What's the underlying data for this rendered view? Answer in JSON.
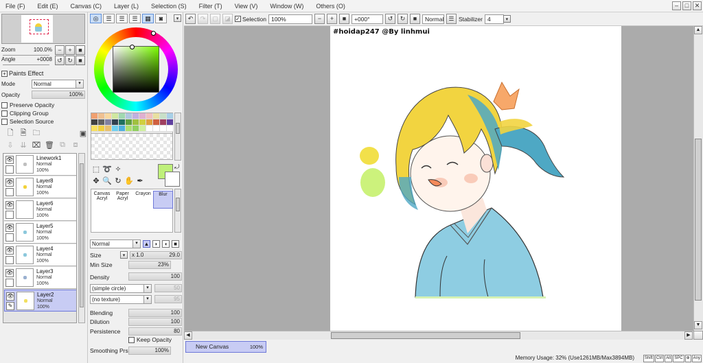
{
  "menu": [
    "File (F)",
    "Edit (E)",
    "Canvas (C)",
    "Layer (L)",
    "Selection (S)",
    "Filter (T)",
    "View (V)",
    "Window (W)",
    "Others (O)"
  ],
  "window_controls": [
    "–",
    "□",
    "✕"
  ],
  "navigator": {
    "zoom_label": "Zoom",
    "zoom_value": "100.0%",
    "angle_label": "Angle",
    "angle_value": "+0008"
  },
  "layer_props": {
    "paints_effect": "Paints Effect",
    "mode_label": "Mode",
    "mode_value": "Normal",
    "opacity_label": "Opacity",
    "opacity_value": "100%",
    "preserve_opacity": "Preserve Opacity",
    "clipping_group": "Clipping Group",
    "selection_source": "Selection Source"
  },
  "layers": [
    {
      "name": "Linework1",
      "mode": "Normal",
      "opacity": "100%",
      "dot": "#c0c0c0"
    },
    {
      "name": "Layer8",
      "mode": "Normal",
      "opacity": "100%",
      "dot": "#f2d23a"
    },
    {
      "name": "Layer6",
      "mode": "Normal",
      "opacity": "100%",
      "dot": "#ffffff"
    },
    {
      "name": "Layer5",
      "mode": "Normal",
      "opacity": "100%",
      "dot": "#8cc8dc"
    },
    {
      "name": "Layer4",
      "mode": "Normal",
      "opacity": "100%",
      "dot": "#8cc8dc"
    },
    {
      "name": "Layer3",
      "mode": "Normal",
      "opacity": "100%",
      "dot": "#9ab0d0"
    },
    {
      "name": "Layer2",
      "mode": "Normal",
      "opacity": "100%",
      "dot": "#f2e060"
    }
  ],
  "palette": [
    "#f0a070",
    "#f0c090",
    "#f8d8a0",
    "#d0e8a0",
    "#a0d8b0",
    "#b0c8e0",
    "#c0b0e0",
    "#e0b0d0",
    "#f0c0c0",
    "#e8e0a0",
    "#c8e0c8",
    "#a8d0e8",
    "#404040",
    "#606060",
    "#8080a0",
    "#304050",
    "#207060",
    "#60a040",
    "#a0c040",
    "#d0d040",
    "#e0a040",
    "#d06040",
    "#a04060",
    "#6040a0",
    "#f8e060",
    "#f0d040",
    "#e8c070",
    "#70d0f0",
    "#50b0e0",
    "#b0e070",
    "#90d060",
    "#d0f0a0",
    "#ffffff",
    "#ffffff",
    "#ffffff",
    "#ffffff"
  ],
  "brushes": [
    {
      "name": "Canvas",
      "sub": "Acryl"
    },
    {
      "name": "Paper",
      "sub": "Acryl"
    },
    {
      "name": "Crayon",
      "sub": ""
    },
    {
      "name": "Blur",
      "sub": ""
    }
  ],
  "brush_props": {
    "blend_mode": "Normal",
    "size_label": "Size",
    "size_mult": "x 1.0",
    "size_value": "29.0",
    "min_size_label": "Min Size",
    "min_size_value": "23%",
    "density_label": "Density",
    "density_value": "100",
    "shape": "(simple circle)",
    "shape_value": "50",
    "texture": "(no texture)",
    "texture_value": "95",
    "blending_label": "Blending",
    "blending_value": "100",
    "dilution_label": "Dilution",
    "dilution_value": "100",
    "persistence_label": "Persistence",
    "persistence_value": "80",
    "keep_opacity": "Keep Opacity",
    "smoothing_label": "Smoothing Prs",
    "smoothing_value": "100%"
  },
  "toolbar": {
    "selection_label": "Selection",
    "zoom_value": "100%",
    "rotation_value": "+000°",
    "mode_value": "Normal",
    "stabilizer_label": "Stabilizer",
    "stabilizer_value": "4"
  },
  "canvas": {
    "watermark": "#hoidap247 @By linhmui"
  },
  "canvas_tab": {
    "name": "New Canvas",
    "zoom": "100%"
  },
  "status": {
    "memory": "Memory Usage: 32% (Use1261MB/Max3894MB)",
    "keys": [
      "Shift",
      "Ctrl",
      "Alt",
      "SPC",
      "⊕",
      "Any"
    ]
  },
  "colors": {
    "main_color": "#bff07a",
    "sub_color": "#ffffff",
    "selection_highlight": "#c8ccf4"
  }
}
